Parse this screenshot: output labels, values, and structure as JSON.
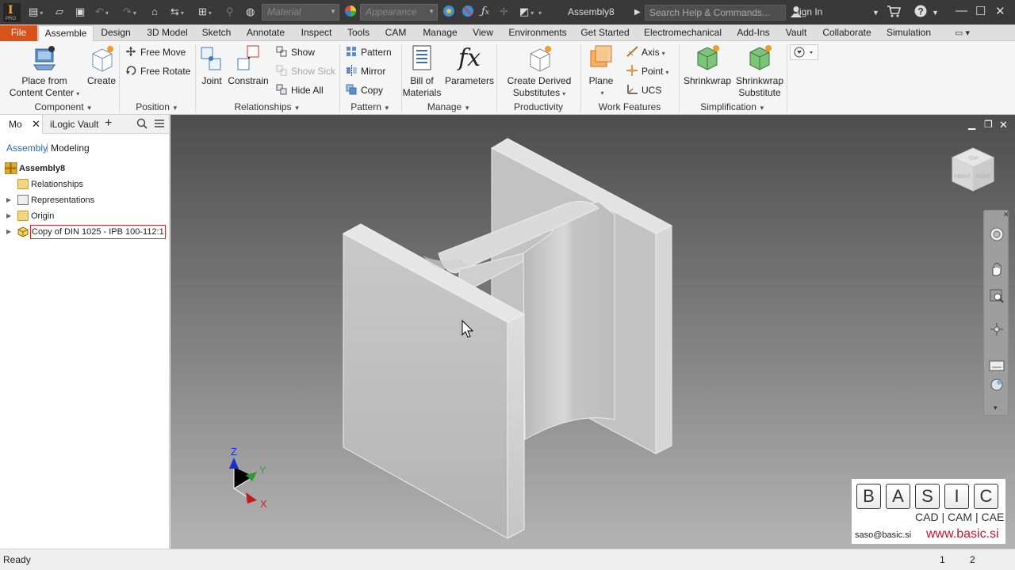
{
  "app": {
    "logo_letter": "I",
    "logo_sub": "PRO",
    "document_title": "Assembly8",
    "material_placeholder": "Material",
    "appearance_placeholder": "Appearance",
    "help_search_placeholder": "Search Help & Commands...",
    "sign_in": "Sign In",
    "help_symbol": "?"
  },
  "ribbon_tabs": [
    "File",
    "Assemble",
    "Design",
    "3D Model",
    "Sketch",
    "Annotate",
    "Inspect",
    "Tools",
    "CAM",
    "Manage",
    "View",
    "Environments",
    "Get Started",
    "Electromechanical",
    "Add-Ins",
    "Vault",
    "Collaborate",
    "Simulation"
  ],
  "ribbon": {
    "component": {
      "label": "Component",
      "place_line1": "Place from",
      "place_line2": "Content Center",
      "create": "Create"
    },
    "position": {
      "label": "Position",
      "free_move": "Free Move",
      "free_rotate": "Free Rotate"
    },
    "relationships": {
      "label": "Relationships",
      "joint": "Joint",
      "constrain": "Constrain",
      "show": "Show",
      "show_sick": "Show Sick",
      "hide_all": "Hide All"
    },
    "pattern": {
      "label": "Pattern",
      "pattern": "Pattern",
      "mirror": "Mirror",
      "copy": "Copy"
    },
    "manage": {
      "label": "Manage",
      "bom_line1": "Bill of",
      "bom_line2": "Materials",
      "parameters": "Parameters",
      "fx": "fx"
    },
    "productivity": {
      "label": "Productivity",
      "derived_line1": "Create Derived",
      "derived_line2": "Substitutes"
    },
    "work_features": {
      "label": "Work Features",
      "plane": "Plane",
      "axis": "Axis",
      "point": "Point",
      "ucs": "UCS"
    },
    "simplification": {
      "label": "Simplification",
      "shrinkwrap": "Shrinkwrap",
      "shrinkwrap_sub_line1": "Shrinkwrap",
      "shrinkwrap_sub_line2": "Substitute"
    }
  },
  "browser": {
    "tabs": [
      "Mo",
      "iLogic",
      "Vault"
    ],
    "sub_tabs": [
      "Assembly",
      "Modeling"
    ],
    "tree": [
      {
        "label": "Assembly8",
        "bold": true
      },
      {
        "label": "Relationships"
      },
      {
        "label": "Representations"
      },
      {
        "label": "Origin"
      },
      {
        "label": "Copy of DIN 1025 - IPB 100-112:1",
        "selected": true
      }
    ]
  },
  "viewcube": {
    "top": "TOP",
    "front": "FRONT",
    "right": "RIGHT"
  },
  "triad": {
    "x": "X",
    "y": "Y",
    "z": "Z"
  },
  "logo": {
    "letters": [
      "B",
      "A",
      "S",
      "I",
      "C"
    ],
    "tagline": "CAD | CAM | CAE",
    "email": "saso@basic.si",
    "url": "www.basic.si"
  },
  "status": {
    "text": "Ready",
    "count1": "1",
    "count2": "2"
  },
  "colors": {
    "file_tab": "#d6541c",
    "title_bar": "#393939",
    "accent_blue": "#1f6fb5",
    "logo_red": "#d0112b"
  }
}
